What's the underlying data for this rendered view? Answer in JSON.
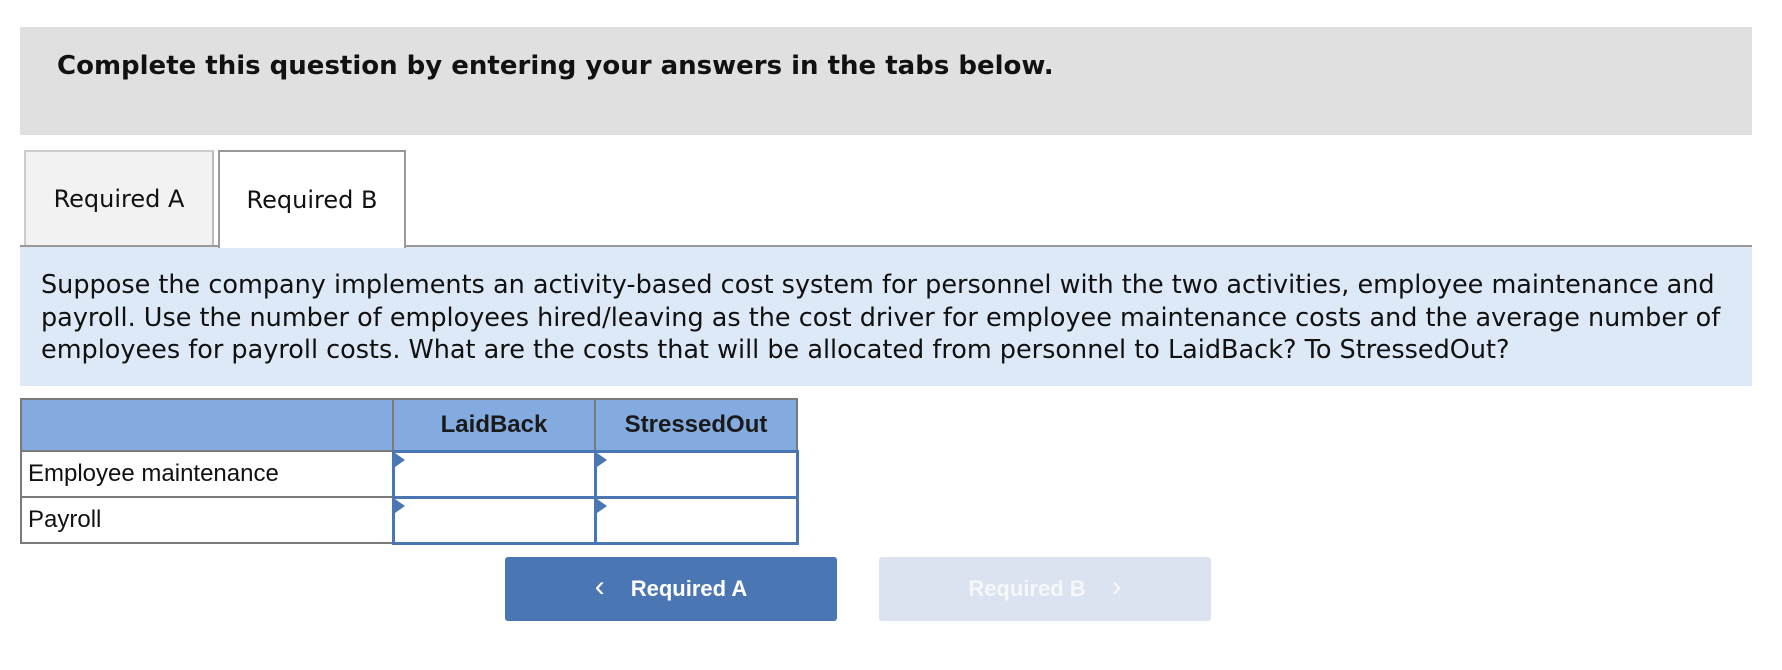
{
  "instructions": "Complete this question by entering your answers in the tabs below.",
  "tabs": [
    {
      "label": "Required A",
      "active": false
    },
    {
      "label": "Required B",
      "active": true
    }
  ],
  "question": "Suppose the company implements an activity-based cost system for personnel with the two activities, employee maintenance and payroll. Use the number of employees hired/leaving as the cost driver for employee maintenance costs and the average number of employees for payroll costs. What are the costs that will be allocated from personnel to LaidBack? To StressedOut?",
  "table": {
    "columns": [
      "",
      "LaidBack",
      "StressedOut"
    ],
    "rows": [
      {
        "label": "Employee maintenance",
        "values": [
          "",
          ""
        ]
      },
      {
        "label": "Payroll",
        "values": [
          "",
          ""
        ]
      }
    ]
  },
  "nav": {
    "prev_label": "Required A",
    "prev_icon": "chevron-left-icon",
    "next_label": "Required B",
    "next_icon": "chevron-right-icon",
    "next_disabled": true
  },
  "colors": {
    "header_gray": "#e0e0e0",
    "panel_blue": "#dde9f7",
    "table_header_blue": "#84abe0",
    "input_border": "#4a76b3",
    "button_primary": "#4a77b4",
    "button_disabled": "#dae3ef"
  }
}
